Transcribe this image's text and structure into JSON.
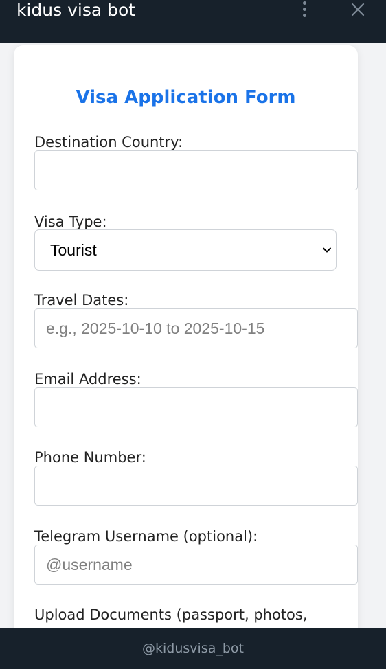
{
  "header": {
    "title": "kidus visa bot",
    "menu_icon": "more-vertical-icon",
    "close_icon": "close-icon"
  },
  "form": {
    "title": "Visa Application Form",
    "destination": {
      "label": "Destination Country:",
      "value": ""
    },
    "visa_type": {
      "label": "Visa Type:",
      "selected": "Tourist"
    },
    "travel_dates": {
      "label": "Travel Dates:",
      "placeholder": "e.g., 2025-10-10 to 2025-10-15"
    },
    "email": {
      "label": "Email Address:",
      "value": ""
    },
    "phone": {
      "label": "Phone Number:",
      "value": ""
    },
    "telegram": {
      "label": "Telegram Username (optional):",
      "placeholder": "@username"
    },
    "upload": {
      "label": "Upload Documents (passport, photos,"
    }
  },
  "footer": {
    "text": "@kidusvisa_bot"
  },
  "colors": {
    "header_bg": "#17212b",
    "accent": "#1a73e8"
  }
}
